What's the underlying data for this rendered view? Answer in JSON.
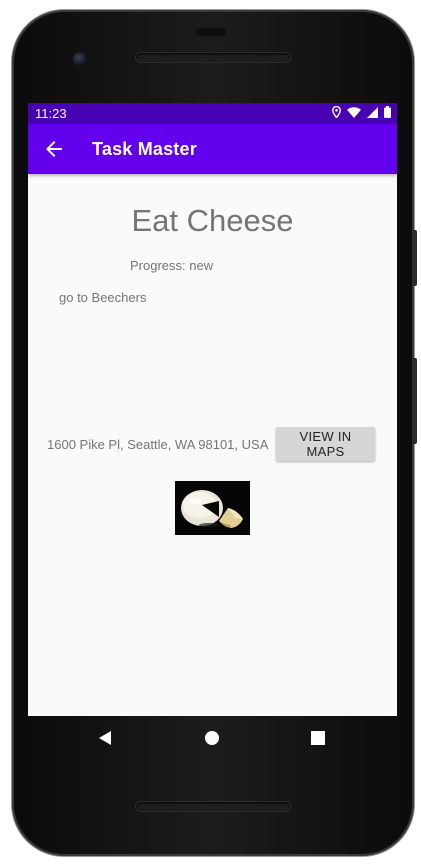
{
  "status_bar": {
    "time": "11:23",
    "icons": [
      "location-icon",
      "wifi-icon",
      "cell-signal-icon",
      "battery-icon"
    ]
  },
  "app_bar": {
    "title": "Task Master",
    "back_icon": "arrow-back-icon"
  },
  "task": {
    "title": "Eat Cheese",
    "progress": "Progress: new",
    "body": "go to Beechers",
    "address": "1600 Pike Pl, Seattle, WA 98101, USA",
    "maps_button_label": "VIEW IN MAPS",
    "image": "cheese-photo"
  },
  "nav_bar": {
    "icons": [
      "back-triangle-icon",
      "home-circle-icon",
      "recents-square-icon"
    ]
  },
  "colors": {
    "status_bar": "#4800b3",
    "app_bar": "#6200ee",
    "screen_background": "#fafafa",
    "text_secondary": "#757575",
    "button_background": "#d6d6d6"
  }
}
